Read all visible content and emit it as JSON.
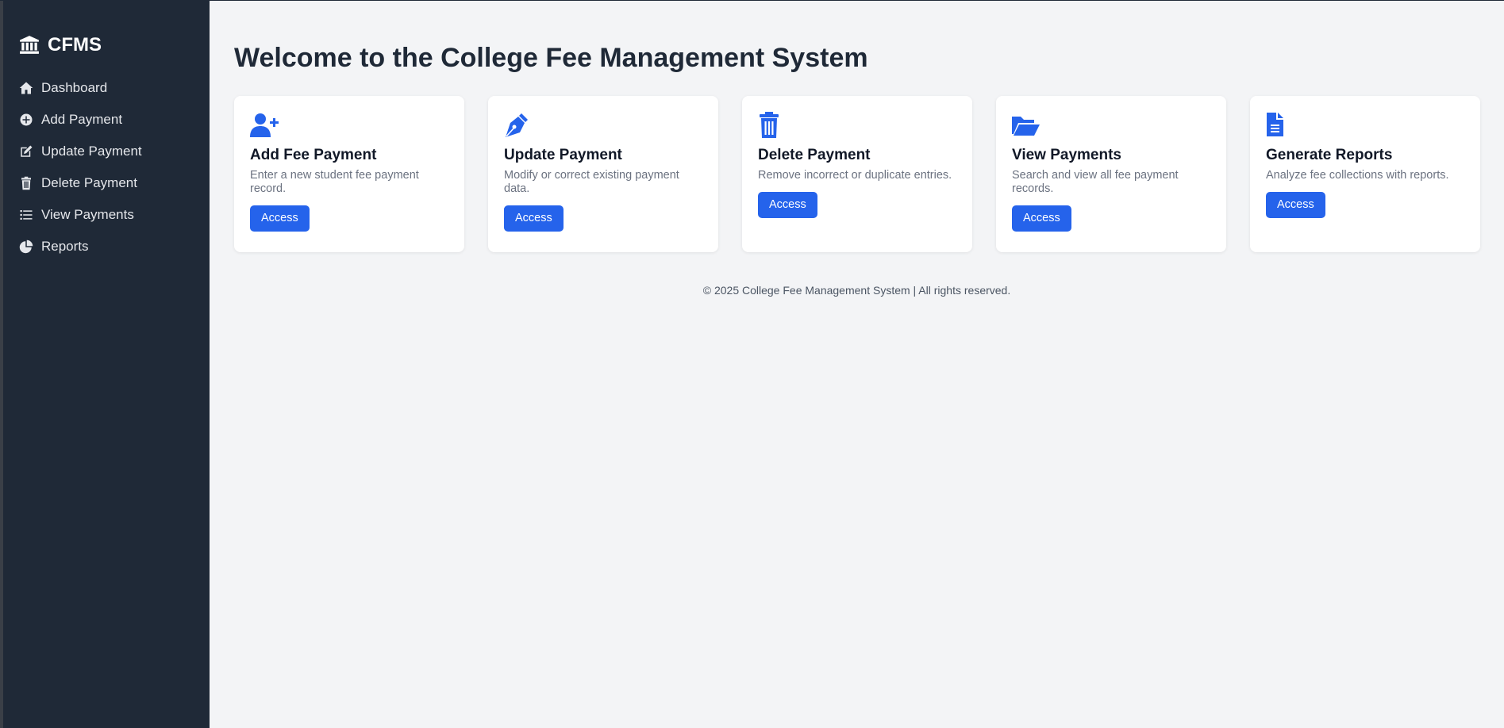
{
  "sidebar": {
    "brand": "CFMS",
    "brand_icon": "bank-icon",
    "items": [
      {
        "label": "Dashboard",
        "icon": "home-icon"
      },
      {
        "label": "Add Payment",
        "icon": "plus-circle-icon"
      },
      {
        "label": "Update Payment",
        "icon": "edit-icon"
      },
      {
        "label": "Delete Payment",
        "icon": "trash-icon"
      },
      {
        "label": "View Payments",
        "icon": "list-icon"
      },
      {
        "label": "Reports",
        "icon": "pie-chart-icon"
      }
    ]
  },
  "main": {
    "title": "Welcome to the College Fee Management System",
    "cards": [
      {
        "title": "Add Fee Payment",
        "desc": "Enter a new student fee payment record.",
        "button": "Access",
        "icon": "user-plus-icon"
      },
      {
        "title": "Update Payment",
        "desc": "Modify or correct existing payment data.",
        "button": "Access",
        "icon": "pen-nib-icon"
      },
      {
        "title": "Delete Payment",
        "desc": "Remove incorrect or duplicate entries.",
        "button": "Access",
        "icon": "trash-icon"
      },
      {
        "title": "View Payments",
        "desc": "Search and view all fee payment records.",
        "button": "Access",
        "icon": "folder-open-icon"
      },
      {
        "title": "Generate Reports",
        "desc": "Analyze fee collections with reports.",
        "button": "Access",
        "icon": "file-text-icon"
      }
    ]
  },
  "footer": {
    "text": "© 2025 College Fee Management System | All rights reserved."
  },
  "colors": {
    "sidebar_bg": "#1f2937",
    "accent": "#2563eb",
    "page_bg": "#f3f4f6"
  }
}
